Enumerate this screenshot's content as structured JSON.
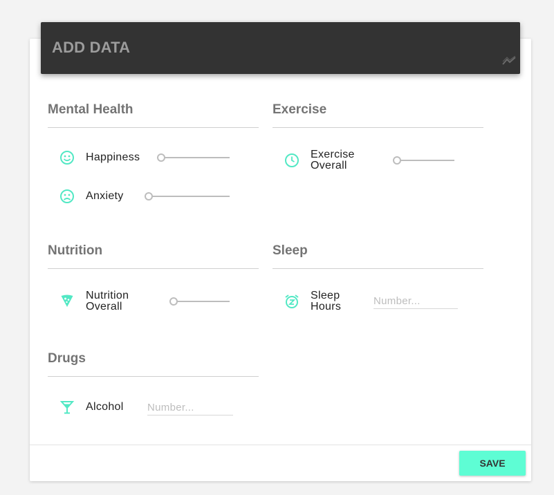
{
  "header": {
    "title": "ADD DATA",
    "icon": "trend-icon"
  },
  "accent_color": "#5efdd4",
  "icon_color": "#52e8c4",
  "sections": {
    "mental_health": {
      "title": "Mental Health",
      "items": [
        {
          "label": "Happiness",
          "icon": "smiley-face-icon",
          "slider_value": 0
        },
        {
          "label": "Anxiety",
          "icon": "sad-face-icon",
          "slider_value": 0
        }
      ]
    },
    "exercise": {
      "title": "Exercise",
      "items": [
        {
          "label_line1": "Exercise",
          "label_line2": "Overall",
          "icon": "clock-icon",
          "slider_value": 0
        }
      ]
    },
    "nutrition": {
      "title": "Nutrition",
      "items": [
        {
          "label_line1": "Nutrition",
          "label_line2": "Overall",
          "icon": "pizza-icon",
          "slider_value": 0
        }
      ]
    },
    "sleep": {
      "title": "Sleep",
      "items": [
        {
          "label_line1": "Sleep",
          "label_line2": "Hours",
          "icon": "alarm-snooze-icon",
          "placeholder": "Number..."
        }
      ]
    },
    "drugs": {
      "title": "Drugs",
      "items": [
        {
          "label": "Alcohol",
          "icon": "cocktail-icon",
          "placeholder": "Number..."
        }
      ]
    }
  },
  "footer": {
    "save_label": "SAVE"
  }
}
